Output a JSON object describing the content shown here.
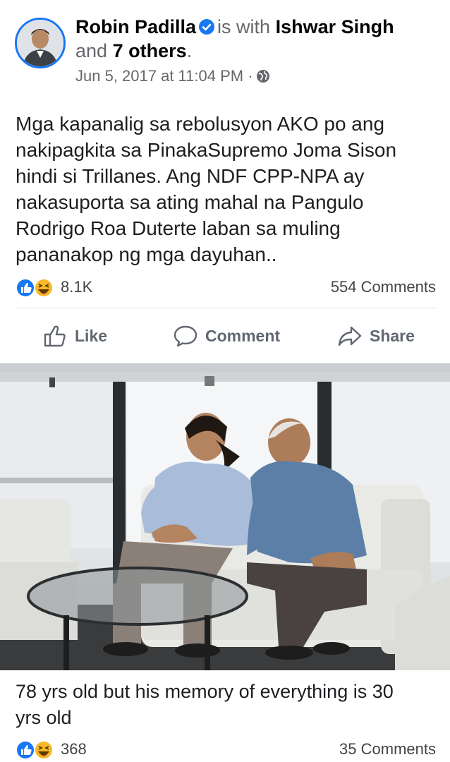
{
  "post": {
    "author": "Robin Padilla",
    "with_text": "is with",
    "tagged_name": "Ishwar Singh",
    "and_text": "and",
    "others_text": "7 others",
    "period": ".",
    "timestamp": "Jun 5, 2017 at 11:04 PM",
    "separator": "·",
    "privacy_icon": "globe-icon",
    "text": "Mga kapanalig sa rebolusyon AKO po ang\nnakipagkita sa PinakaSupremo Joma Sison\nhindi si Trillanes. Ang NDF CPP-NPA ay\nnakasuporta sa ating mahal na Pangulo\nRodrigo Roa Duterte laban sa muling\npananakop ng mga dayuhan..",
    "reaction_count": "8.1K",
    "comments": "554 Comments"
  },
  "actions": {
    "like": "Like",
    "comment": "Comment",
    "share": "Share"
  },
  "photo_post": {
    "caption": "78 yrs old but his memory of everything is 30\nyrs old",
    "reaction_count": "368",
    "comments": "35 Comments"
  },
  "colors": {
    "brand_blue": "#1877f2",
    "muted": "#65676b",
    "laugh_yellow": "#f7b928"
  }
}
